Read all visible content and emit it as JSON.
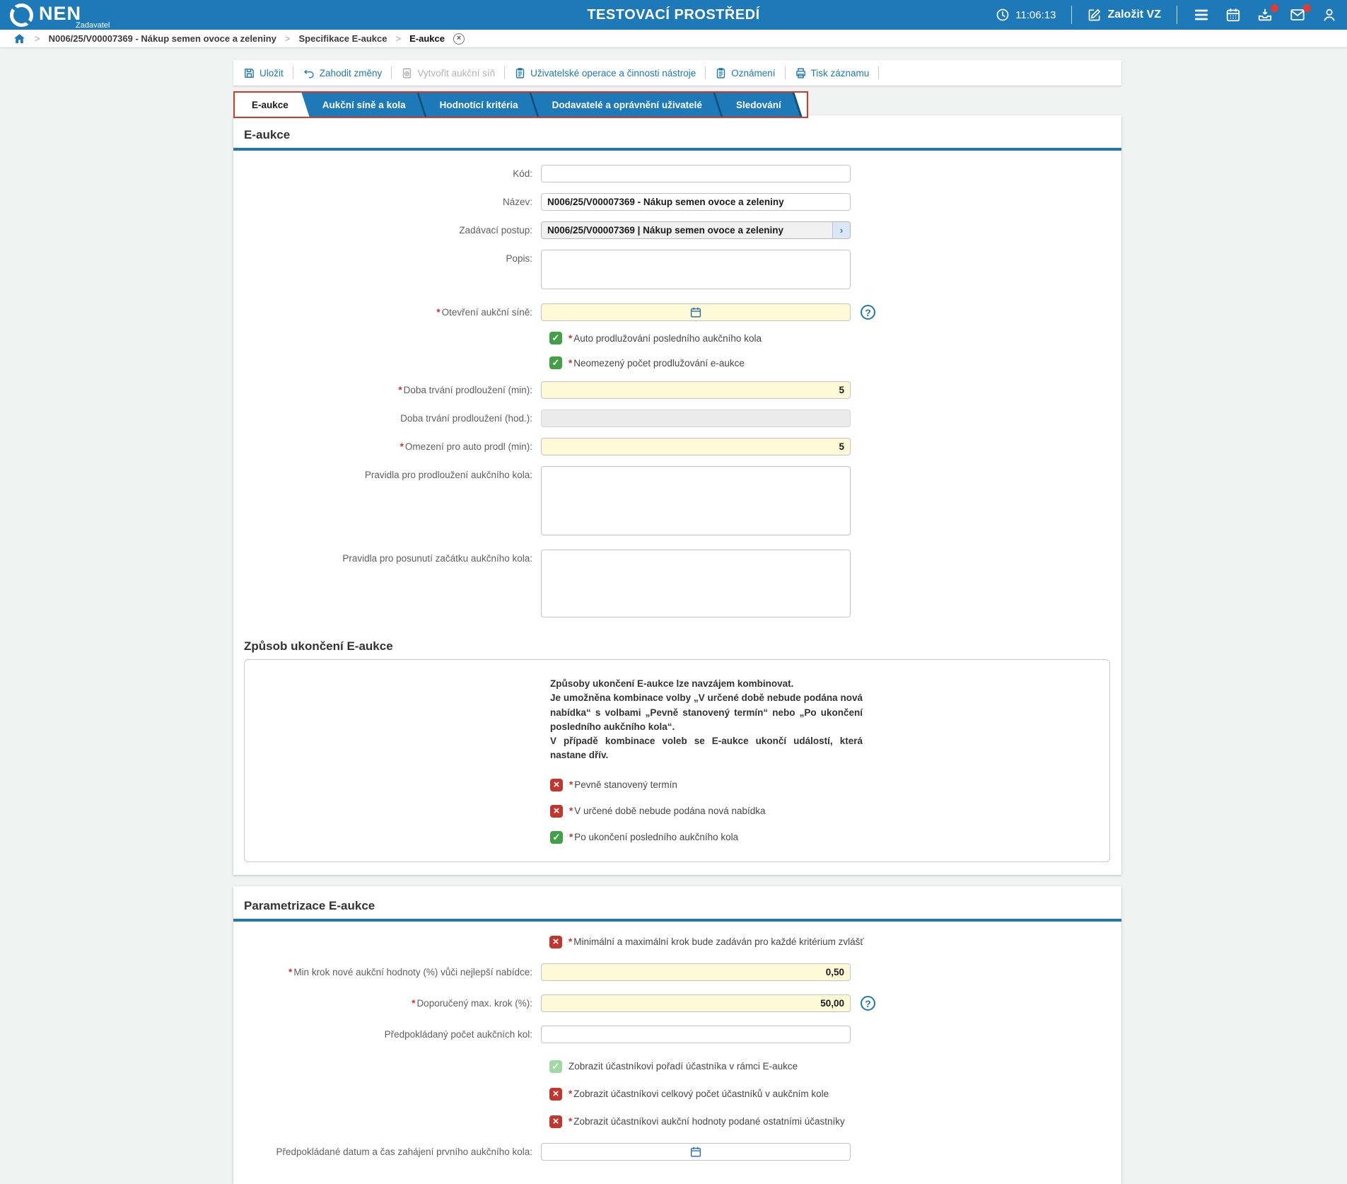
{
  "header": {
    "brand": "NEN",
    "brand_sub": "Zadavatel",
    "environment_title": "TESTOVACÍ PROSTŘEDÍ",
    "time": "11:06:13",
    "create_vz_label": "Založit VZ",
    "icon_names": [
      "clock-icon",
      "edit-icon",
      "menu-icon",
      "calendar-icon",
      "inbox-icon",
      "mail-icon",
      "user-icon"
    ]
  },
  "breadcrumb": {
    "items": [
      {
        "label": "N006/25/V00007369 - Nákup semen ovoce a zeleniny"
      },
      {
        "label": "Specifikace E-aukce"
      },
      {
        "label": "E-aukce"
      }
    ]
  },
  "toolbar": {
    "items": [
      {
        "label": "Uložit",
        "enabled": true
      },
      {
        "label": "Zahodit změny",
        "enabled": true
      },
      {
        "label": "Vytvořit aukční síň",
        "enabled": false
      },
      {
        "label": "Uživatelské operace a činnosti nástroje",
        "enabled": true
      },
      {
        "label": "Oznámení",
        "enabled": true
      },
      {
        "label": "Tisk záznamu",
        "enabled": true
      }
    ]
  },
  "tabs": [
    {
      "label": "E-aukce",
      "active": true
    },
    {
      "label": "Aukční síně a kola",
      "active": false
    },
    {
      "label": "Hodnotící kritéria",
      "active": false
    },
    {
      "label": "Dodavatelé a oprávnění uživatelé",
      "active": false
    },
    {
      "label": "Sledování",
      "active": false
    }
  ],
  "ui": {
    "required_marker": "*"
  },
  "colors": {
    "accent_blue": "#1d79b8",
    "tab_border_red": "#d4392c",
    "required_red": "#d32f2f",
    "check_green": "#43a047",
    "check_green_disabled": "#a2d8a5",
    "check_red": "#c2362f",
    "field_yellow": "#fdf9d6"
  },
  "section_eaukce": {
    "title": "E-aukce",
    "kod": {
      "label": "Kód:",
      "value": ""
    },
    "nazev": {
      "label": "Název:",
      "value": "N006/25/V00007369 - Nákup semen ovoce a zeleniny"
    },
    "zadavaci_postup": {
      "label": "Zadávací postup:",
      "value": "N006/25/V00007369 | Nákup semen ovoce a zeleniny"
    },
    "popis": {
      "label": "Popis:",
      "value": ""
    },
    "otevreni_sine": {
      "label": "Otevření aukční síně:",
      "value": "",
      "required": true
    },
    "cb_auto_prodluzovani": {
      "label": "Auto prodlužování posledního aukčního kola",
      "state": "checked",
      "required": true
    },
    "cb_neomezeny_pocet": {
      "label": "Neomezený počet prodlužování e-aukce",
      "state": "checked",
      "required": true
    },
    "doba_trvani_min": {
      "label": "Doba trvání prodloužení (min):",
      "value": "5",
      "required": true
    },
    "doba_trvani_hod": {
      "label": "Doba trvání prodloužení (hod.):",
      "value": "",
      "disabled": true
    },
    "omezeni_auto_prodl": {
      "label": "Omezení pro auto prodl (min):",
      "value": "5",
      "required": true
    },
    "pravidla_prodlouzeni": {
      "label": "Pravidla pro prodloužení aukčního kola:",
      "value": ""
    },
    "pravidla_posunuti": {
      "label": "Pravidla pro posunutí začátku aukčního kola:",
      "value": ""
    }
  },
  "section_zpusob": {
    "title": "Způsob ukončení E-aukce",
    "info_line1": "Způsoby ukončení E-aukce lze navzájem kombinovat.",
    "info_line2": "Je umožněna kombinace volby „V určené době nebude podána nová nabídka“ s volbami „Pevně stanovený termín“ nebo „Po ukončení posledního aukčního kola“.",
    "info_line3": "V případě kombinace voleb se E-aukce ukončí událostí, která nastane dřív.",
    "cb_pevny_termin": {
      "label": "Pevně stanovený termín",
      "state": "unchecked",
      "required": true
    },
    "cb_urcena_doba": {
      "label": "V určené době nebude podána nová nabídka",
      "state": "unchecked",
      "required": true
    },
    "cb_po_ukonceni": {
      "label": "Po ukončení posledního aukčního kola",
      "state": "checked",
      "required": true
    }
  },
  "section_parametrizace": {
    "title": "Parametrizace E-aukce",
    "cb_min_max_krok": {
      "label": "Minimální a maximální krok bude zadáván pro každé kritérium zvlášť",
      "state": "unchecked",
      "required": true
    },
    "min_krok": {
      "label": "Min krok nové aukční hodnoty (%) vůči nejlepší nabídce:",
      "value": "0,50",
      "required": true
    },
    "doporuceny_max_krok": {
      "label": "Doporučený max. krok (%):",
      "value": "50,00",
      "required": true
    },
    "pocet_kol": {
      "label": "Předpokládaný počet aukčních kol:",
      "value": ""
    },
    "cb_poradi": {
      "label": "Zobrazit účastníkovi pořadí účastníka v rámci E-aukce",
      "state": "checked-disabled"
    },
    "cb_celkovy_pocet": {
      "label": "Zobrazit účastníkovi celkový počet účastníků v aukčním kole",
      "state": "unchecked",
      "required": true
    },
    "cb_aukcni_hodnoty": {
      "label": "Zobrazit účastníkovi aukční hodnoty podané ostatními účastníky",
      "state": "unchecked",
      "required": true
    },
    "datum_zahajeni": {
      "label": "Předpokládané datum a čas zahájení prvního aukčního kola:",
      "value": ""
    }
  }
}
